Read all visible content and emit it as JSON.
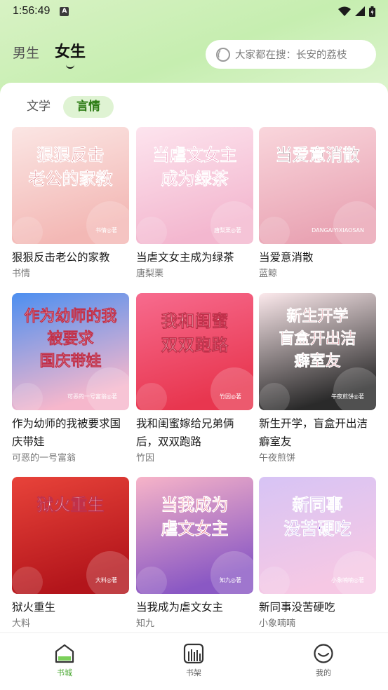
{
  "status_bar": {
    "time": "1:56:49",
    "notification_letter": "A"
  },
  "header": {
    "gender_tabs": [
      {
        "label": "男生",
        "active": false
      },
      {
        "label": "女生",
        "active": true
      }
    ],
    "search": {
      "placeholder": "大家都在搜：长安的荔枝"
    }
  },
  "category_tabs": [
    {
      "label": "文学",
      "active": false
    },
    {
      "label": "言情",
      "active": true
    }
  ],
  "books": [
    {
      "title": "狠狠反击老公的家教",
      "author": "书情",
      "cover": {
        "bg1": "#fbe6e4",
        "bg2": "#f3b8b5",
        "text_color": "#c21d2b",
        "lines": [
          "狠狠反击",
          "老公的家教"
        ],
        "tag": "书情◎著"
      }
    },
    {
      "title": "当虐文女主成为绿茶",
      "author": "唐梨栗",
      "cover": {
        "bg1": "#fde4ee",
        "bg2": "#f3b7cf",
        "text_color": "#e04e8c",
        "lines": [
          "当虐文女主",
          "成为绿茶"
        ],
        "tag": "唐梨栗◎著"
      }
    },
    {
      "title": "当爱意消散",
      "author": "蓝鲸",
      "cover": {
        "bg1": "#f9d6dc",
        "bg2": "#e9a4b4",
        "text_color": "#5a2030",
        "lines": [
          "当爱意消散"
        ],
        "tag": "DANGAIYIXIAOSAN"
      }
    },
    {
      "title": "作为幼师的我被要求国庆带娃",
      "author": "可恶的一号富翁",
      "cover": {
        "bg1": "#4d8ff0",
        "bg2": "#f6b7cc",
        "text_color": "#ffffff",
        "lines": [
          "作为幼师的我",
          "被要求",
          "国庆带娃"
        ],
        "tag": "可恶的一号富翁◎著"
      }
    },
    {
      "title": "我和闺蜜嫁给兄弟俩后，双双跑路",
      "author": "竹因",
      "cover": {
        "bg1": "#f76b8e",
        "bg2": "#e8364f",
        "text_color": "#ffffff",
        "lines": [
          "我和闺蜜",
          "双双跑路"
        ],
        "tag": "竹因◎著"
      }
    },
    {
      "title": "新生开学，盲盒开出洁癖室友",
      "author": "午夜煎饼",
      "cover": {
        "bg1": "#fce9ec",
        "bg2": "#2a2a2a",
        "text_color": "#b51428",
        "lines": [
          "新生开学",
          "盲盒开出洁",
          "癖室友"
        ],
        "tag": "午夜煎饼◎著"
      }
    },
    {
      "title": "狱火重生",
      "author": "大料",
      "cover": {
        "bg1": "#e8433a",
        "bg2": "#b3151b",
        "text_color": "#ffffff",
        "lines": [
          "狱火重生"
        ],
        "tag": "大料◎著"
      }
    },
    {
      "title": "当我成为虐文女主",
      "author": "知九",
      "cover": {
        "bg1": "#f7b4c8",
        "bg2": "#8a58c4",
        "text_color": "#e2324e",
        "lines": [
          "当我成为",
          "虐文女主"
        ],
        "tag": "知九◎著"
      }
    },
    {
      "title": "新同事没苦硬吃",
      "author": "小象喃喃",
      "cover": {
        "bg1": "#d7c4f5",
        "bg2": "#f6c8e4",
        "text_color": "#7a3fd0",
        "lines": [
          "新同事",
          "没苦硬吃"
        ],
        "tag": "小象喃喃◎著"
      }
    }
  ],
  "bottom_nav": [
    {
      "label": "书城",
      "icon": "bookstore-icon",
      "active": true
    },
    {
      "label": "书架",
      "icon": "bookshelf-icon",
      "active": false
    },
    {
      "label": "我的",
      "icon": "profile-icon",
      "active": false
    }
  ],
  "colors": {
    "accent": "#4aa832",
    "header_bg": "#c6eeb0",
    "tab_active_bg": "#dff3d3"
  }
}
